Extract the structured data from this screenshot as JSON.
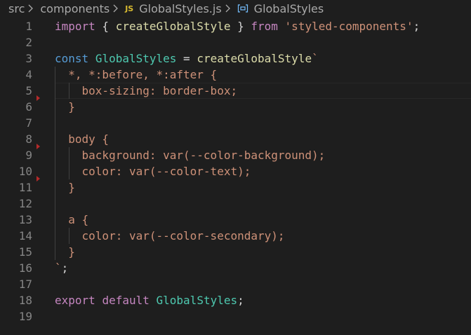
{
  "breadcrumb": {
    "items": [
      "src",
      "components",
      "GlobalStyles.js",
      "GlobalStyles"
    ],
    "file_badge": "JS"
  },
  "editor": {
    "line_numbers": [
      "1",
      "2",
      "3",
      "4",
      "5",
      "6",
      "7",
      "8",
      "9",
      "10",
      "11",
      "12",
      "13",
      "14",
      "15",
      "16",
      "17",
      "18",
      "19"
    ],
    "lines": [
      [
        {
          "t": "kw",
          "v": "import"
        },
        {
          "t": "punc",
          "v": " { "
        },
        {
          "t": "fn",
          "v": "createGlobalStyle"
        },
        {
          "t": "punc",
          "v": " } "
        },
        {
          "t": "kw",
          "v": "from"
        },
        {
          "t": "punc",
          "v": " "
        },
        {
          "t": "str",
          "v": "'styled-components'"
        },
        {
          "t": "punc",
          "v": ";"
        }
      ],
      [],
      [
        {
          "t": "decl",
          "v": "const"
        },
        {
          "t": "punc",
          "v": " "
        },
        {
          "t": "cls",
          "v": "GlobalStyles"
        },
        {
          "t": "punc",
          "v": " = "
        },
        {
          "t": "fn",
          "v": "createGlobalStyle"
        },
        {
          "t": "str",
          "v": "`"
        }
      ],
      [
        {
          "t": "css",
          "v": "  *, *:before, *:after {"
        }
      ],
      [
        {
          "t": "css",
          "v": "    box-sizing: border-box;"
        }
      ],
      [
        {
          "t": "css",
          "v": "  }"
        }
      ],
      [],
      [
        {
          "t": "css",
          "v": "  body {"
        }
      ],
      [
        {
          "t": "css",
          "v": "    background: var(--color-background);"
        }
      ],
      [
        {
          "t": "css",
          "v": "    color: var(--color-text);"
        }
      ],
      [
        {
          "t": "css",
          "v": "  }"
        }
      ],
      [],
      [
        {
          "t": "css",
          "v": "  a {"
        }
      ],
      [
        {
          "t": "css",
          "v": "    color: var(--color-secondary);"
        }
      ],
      [
        {
          "t": "css",
          "v": "  }"
        }
      ],
      [
        {
          "t": "str",
          "v": "`"
        },
        {
          "t": "punc",
          "v": ";"
        }
      ],
      [],
      [
        {
          "t": "kw",
          "v": "export"
        },
        {
          "t": "punc",
          "v": " "
        },
        {
          "t": "kw",
          "v": "default"
        },
        {
          "t": "punc",
          "v": " "
        },
        {
          "t": "cls",
          "v": "GlobalStyles"
        },
        {
          "t": "punc",
          "v": ";"
        }
      ],
      []
    ],
    "current_line": 5
  },
  "colors": {
    "background": "#1e1e1e",
    "keyword": "#c586c0",
    "declaration": "#569cd6",
    "function": "#dcdcaa",
    "class": "#4ec9b0",
    "string": "#ce9178",
    "line_number": "#858585",
    "fold_marker": "#b52a2a"
  },
  "icons": [
    "chevron-right-icon",
    "js-file-icon",
    "symbol-variable-icon"
  ]
}
